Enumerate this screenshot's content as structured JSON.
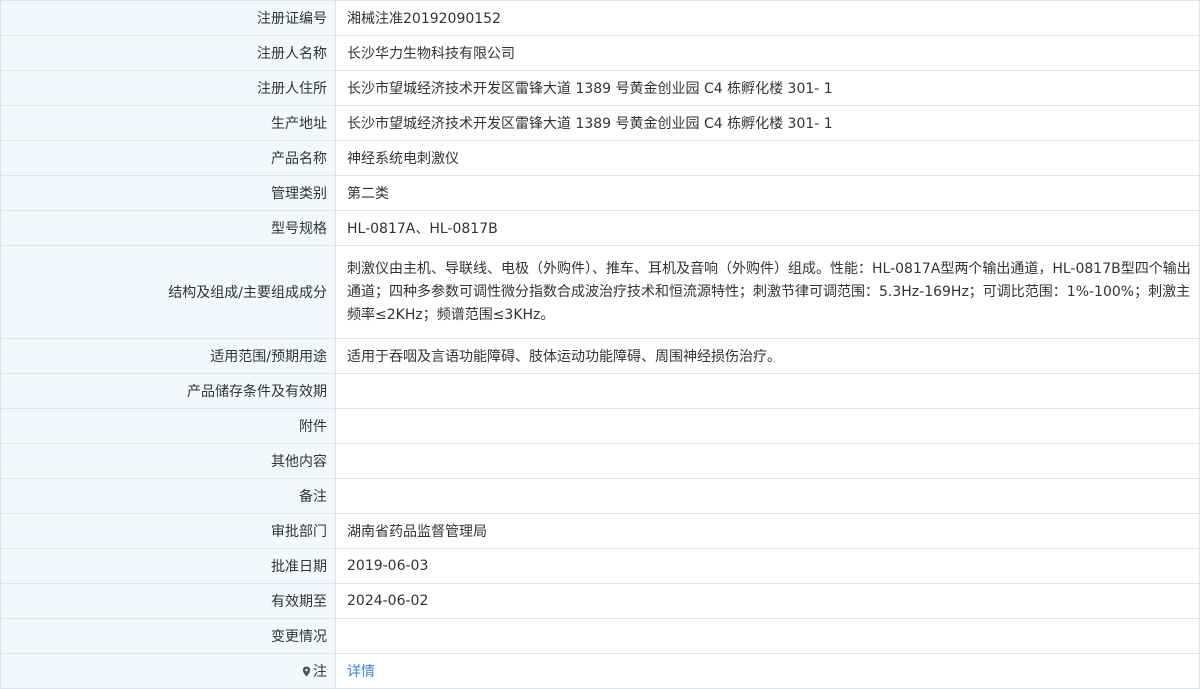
{
  "colors": {
    "label_background": "#f3f8fc",
    "border": "#dde6ee",
    "text": "#333333",
    "link": "#3b84d9"
  },
  "rows": [
    {
      "label": "注册证编号",
      "value": "湘械注准20192090152"
    },
    {
      "label": "注册人名称",
      "value": "长沙华力生物科技有限公司"
    },
    {
      "label": "注册人住所",
      "value": "长沙市望城经济技术开发区雷锋大道 1389 号黄金创业园 C4 栋孵化楼 301- 1"
    },
    {
      "label": "生产地址",
      "value": "长沙市望城经济技术开发区雷锋大道 1389 号黄金创业园 C4 栋孵化楼 301- 1"
    },
    {
      "label": "产品名称",
      "value": "神经系统电刺激仪"
    },
    {
      "label": "管理类别",
      "value": "第二类"
    },
    {
      "label": "型号规格",
      "value": "HL-0817A、HL-0817B"
    },
    {
      "label": "结构及组成/主要组成成分",
      "value": "刺激仪由主机、导联线、电极（外购件）、推车、耳机及音响（外购件）组成。性能：HL-0817A型两个输出通道，HL-0817B型四个输出通道；四种多参数可调性微分指数合成波治疗技术和恒流源特性；刺激节律可调范围：5.3Hz-169Hz；可调比范围：1%-100%；刺激主频率≤2KHz；频谱范围≤3KHz。"
    },
    {
      "label": "适用范围/预期用途",
      "value": "适用于吞咽及言语功能障碍、肢体运动功能障碍、周围神经损伤治疗。"
    },
    {
      "label": "产品储存条件及有效期",
      "value": ""
    },
    {
      "label": "附件",
      "value": ""
    },
    {
      "label": "其他内容",
      "value": ""
    },
    {
      "label": "备注",
      "value": ""
    },
    {
      "label": "审批部门",
      "value": "湖南省药品监督管理局"
    },
    {
      "label": "批准日期",
      "value": "2019-06-03"
    },
    {
      "label": "有效期至",
      "value": "2024-06-02"
    },
    {
      "label": "变更情况",
      "value": ""
    }
  ],
  "note_row": {
    "icon": "map-pin-icon",
    "label": "注",
    "link_text": "详情"
  }
}
